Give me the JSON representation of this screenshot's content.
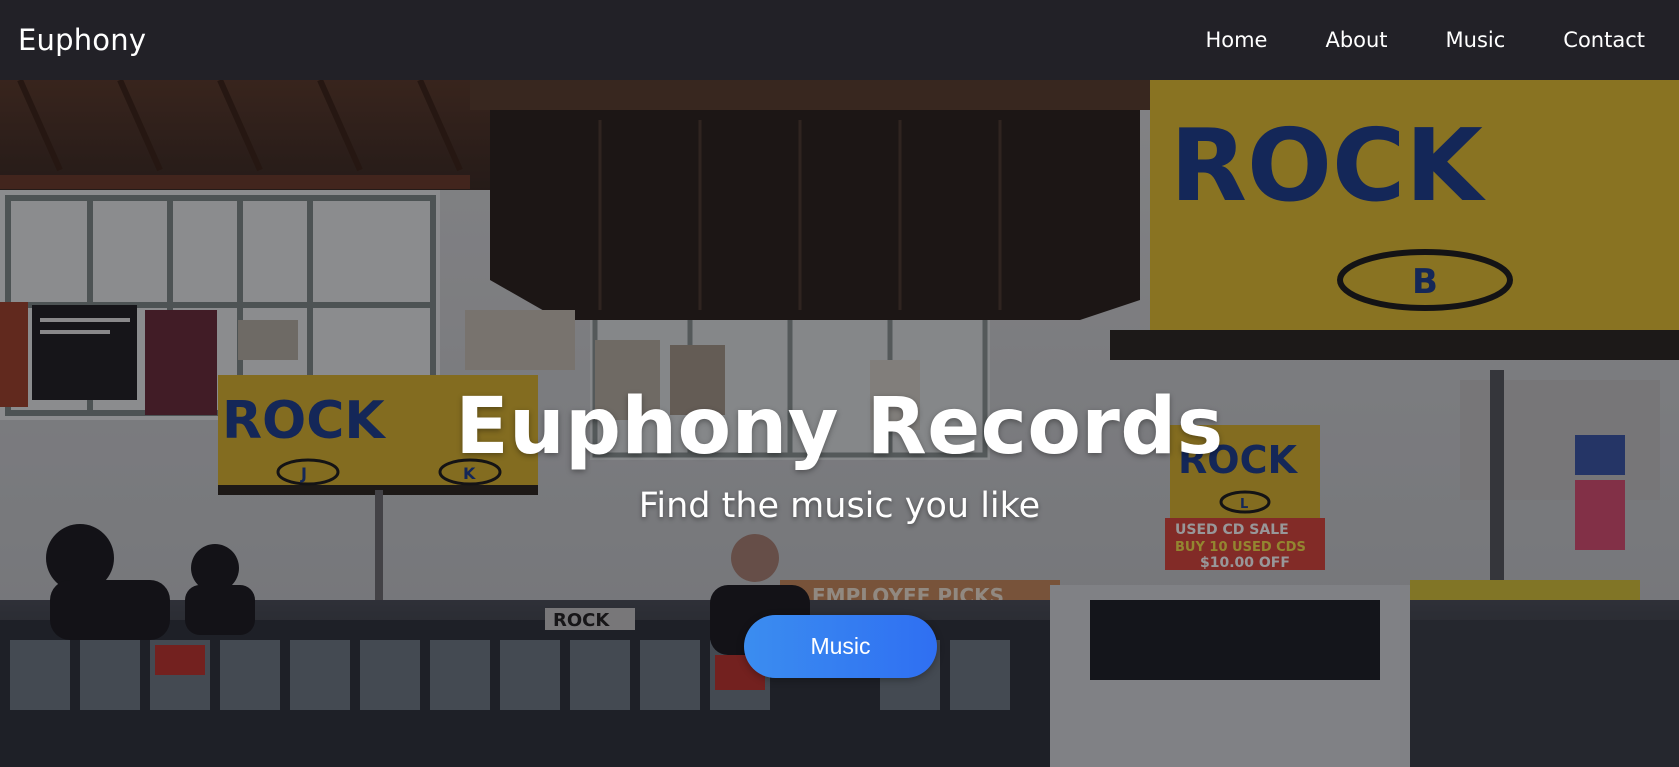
{
  "nav": {
    "brand": "Euphony",
    "links": [
      "Home",
      "About",
      "Music",
      "Contact"
    ]
  },
  "hero": {
    "title": "Euphony Records",
    "subtitle": "Find the music you like",
    "button_label": "Music",
    "background": "record store interior photo",
    "signage": {
      "rock_big": "ROCK",
      "rock_big_letter": "B",
      "rock_left": "ROCK",
      "rock_left_letter": "J",
      "rock_k": "K",
      "rock_right": "ROCK",
      "rock_right_letter": "L",
      "sale_line1": "USED CD SALE",
      "sale_line2": "BUY 10 USED CDS",
      "sale_line3": "$10.00 OFF",
      "employee_picks": "EMPLOYEE PICKS",
      "rack_rock": "ROCK"
    }
  },
  "colors": {
    "navbar_bg": "#222127",
    "button_accent": "#2f7ff2",
    "sign_yellow": "#e9c53a",
    "sign_blue": "#1d3e8f"
  }
}
